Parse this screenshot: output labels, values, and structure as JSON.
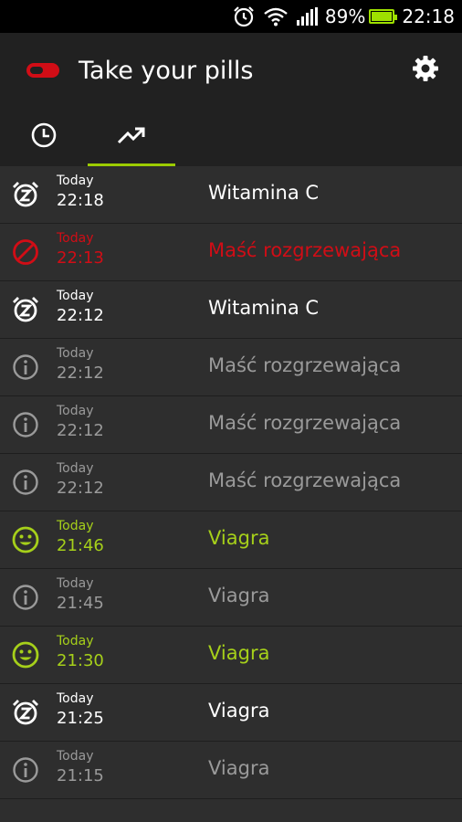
{
  "status_bar": {
    "battery_percent": "89%",
    "time": "22:18",
    "icons": [
      "alarm-icon",
      "wifi-icon",
      "signal-icon",
      "battery-icon"
    ]
  },
  "app_bar": {
    "title": "Take your pills",
    "settings_icon": "gear-icon",
    "logo_icon": "pill-icon"
  },
  "tabs": [
    {
      "icon": "clock-icon",
      "active": false
    },
    {
      "icon": "trending-up-icon",
      "active": true
    }
  ],
  "colors": {
    "accent": "#9ccc00",
    "taken": "#a6d01a",
    "missed": "#d10d16",
    "info": "#9a9a9a",
    "snoozed": "#ffffff"
  },
  "history": [
    {
      "day": "Today",
      "time": "22:18",
      "name": "Witamina C",
      "status": "snoozed",
      "icon": "alarm-snooze-icon"
    },
    {
      "day": "Today",
      "time": "22:13",
      "name": "Maść rozgrzewająca",
      "status": "missed",
      "icon": "block-icon"
    },
    {
      "day": "Today",
      "time": "22:12",
      "name": "Witamina C",
      "status": "snoozed",
      "icon": "alarm-snooze-icon"
    },
    {
      "day": "Today",
      "time": "22:12",
      "name": "Maść rozgrzewająca",
      "status": "info",
      "icon": "info-icon"
    },
    {
      "day": "Today",
      "time": "22:12",
      "name": "Maść rozgrzewająca",
      "status": "info",
      "icon": "info-icon"
    },
    {
      "day": "Today",
      "time": "22:12",
      "name": "Maść rozgrzewająca",
      "status": "info",
      "icon": "info-icon"
    },
    {
      "day": "Today",
      "time": "21:46",
      "name": "Viagra",
      "status": "taken",
      "icon": "smiley-icon"
    },
    {
      "day": "Today",
      "time": "21:45",
      "name": "Viagra",
      "status": "info",
      "icon": "info-icon"
    },
    {
      "day": "Today",
      "time": "21:30",
      "name": "Viagra",
      "status": "taken",
      "icon": "smiley-icon"
    },
    {
      "day": "Today",
      "time": "21:25",
      "name": "Viagra",
      "status": "snoozed",
      "icon": "alarm-snooze-icon"
    },
    {
      "day": "Today",
      "time": "21:15",
      "name": "Viagra",
      "status": "info",
      "icon": "info-icon"
    }
  ]
}
